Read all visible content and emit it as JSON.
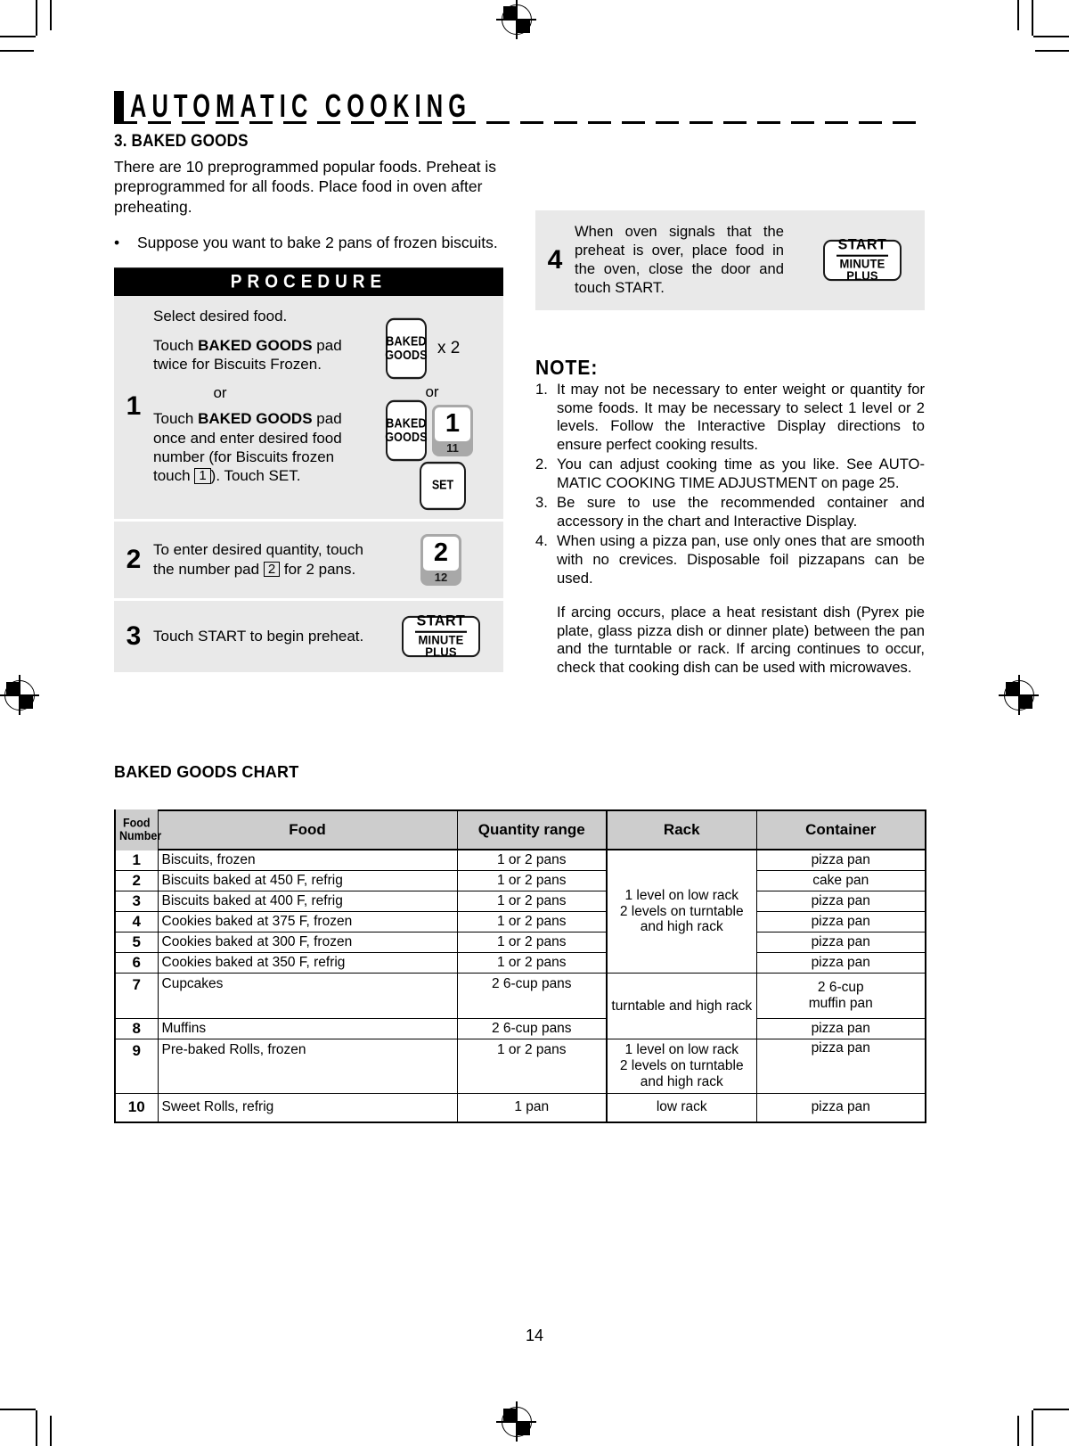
{
  "document": {
    "banner_title": "AUTOMATIC COOKING",
    "page_number": "14"
  },
  "section": {
    "heading": "3. BAKED GOODS",
    "intro": "There are 10 preprogrammed popular foods. Preheat is preprogrammed for all foods. Place food in oven after  preheating.",
    "bullet_mark": "•",
    "bullet_text": "Suppose you want to bake 2 pans of frozen biscuits."
  },
  "procedure": {
    "header": "PROCEDURE",
    "steps": [
      {
        "number": "1",
        "line_intro": "Select desired food.",
        "text_a_pre": "Touch ",
        "text_a_bold": "BAKED GOODS",
        "text_a_post": " pad twice for Biscuits Frozen.",
        "or_label": "or",
        "text_b_pre": "Touch ",
        "text_b_bold": "BAKED GOODS",
        "text_b_post_1": " pad once and enter desired food number (for Biscuits frozen touch ",
        "text_b_boxed": "1",
        "text_b_post_2": "). Touch SET.",
        "keys": {
          "baked_goods_label_line1": "BAKED",
          "baked_goods_label_line2": "GOODS",
          "times_label": "x 2",
          "or_label": "or",
          "num_key_main": "1",
          "num_key_sub": "11",
          "set_label": "SET"
        }
      },
      {
        "number": "2",
        "text_pre": "To enter desired quantity, touch the number pad ",
        "text_boxed": "2",
        "text_post": " for 2 pans.",
        "keys": {
          "num_key_main": "2",
          "num_key_sub": "12"
        }
      },
      {
        "number": "3",
        "text": "Touch  START  to  begin preheat.",
        "keys": {
          "start_top": "START",
          "start_bottom": "MINUTE PLUS"
        }
      },
      {
        "number": "4",
        "text": "When  oven  signals  that the preheat is over, place food in the oven, close the door and touch START.",
        "keys": {
          "start_top": "START",
          "start_bottom": "MINUTE PLUS"
        }
      }
    ]
  },
  "note": {
    "title": "NOTE:",
    "items": [
      {
        "n": "1.",
        "text": "It may not be necessary to enter weight or quantity for some foods. It may be necessary to select 1 level or 2 levels. Follow the Interactive Display directions to ensure perfect cooking results."
      },
      {
        "n": "2.",
        "text": "You can adjust cooking time as you like. See AUTO-MATIC COOKING TIME ADJUSTMENT on page 25."
      },
      {
        "n": "3.",
        "text": "Be sure to use the recommended container and accessory in the chart and Interactive Display."
      },
      {
        "n": "4.",
        "text": "When using a pizza pan, use only ones that are smooth with no crevices. Disposable foil pizzapans can be used."
      }
    ],
    "extra_paragraph": "If arcing occurs, place a heat resistant dish (Pyrex pie plate, glass pizza dish or dinner plate) between the pan and the turntable or rack. If arcing continues to occur, check that cooking dish can be used with microwaves."
  },
  "chart": {
    "title": "BAKED GOODS CHART",
    "headers": {
      "food_number_line1": "Food",
      "food_number_line2": "Number",
      "food": "Food",
      "quantity_range": "Quantity range",
      "rack": "Rack",
      "container": "Container"
    },
    "rows": [
      {
        "number": "1",
        "food": "Biscuits, frozen",
        "quantity": "1 or 2 pans",
        "container": "pizza pan"
      },
      {
        "number": "2",
        "food": "Biscuits baked at 450 F, refrig",
        "quantity": "1 or 2 pans",
        "container": "cake pan"
      },
      {
        "number": "3",
        "food": "Biscuits baked at 400 F, refrig",
        "quantity": "1 or 2 pans",
        "container": "pizza pan"
      },
      {
        "number": "4",
        "food": "Cookies baked at 375 F, frozen",
        "quantity": "1 or 2 pans",
        "container": "pizza pan"
      },
      {
        "number": "5",
        "food": "Cookies baked at 300 F, frozen",
        "quantity": "1 or 2 pans",
        "container": "pizza pan"
      },
      {
        "number": "6",
        "food": "Cookies baked at 350 F, refrig",
        "quantity": "1 or 2 pans",
        "container": "pizza pan"
      },
      {
        "number": "7",
        "food": "Cupcakes",
        "quantity": "2 6-cup pans",
        "container": "2 6-cup\nmuffin pan"
      },
      {
        "number": "8",
        "food": "Muffins",
        "quantity": "2 6-cup pans",
        "container": "pizza pan"
      },
      {
        "number": "9",
        "food": "Pre-baked Rolls, frozen",
        "quantity": "1 or 2 pans",
        "container": "pizza pan"
      },
      {
        "number": "10",
        "food": "Sweet Rolls, refrig",
        "quantity": "1 pan",
        "container": "pizza pan"
      }
    ],
    "rack_groups": [
      {
        "text": "1 level on low rack\n2 levels on turntable\nand high rack",
        "rows": 6
      },
      {
        "text": "turntable and high rack",
        "rows": 2
      },
      {
        "text": "1 level on low rack\n2 levels on turntable\nand high rack",
        "rows": 1
      },
      {
        "text": "low rack",
        "rows": 1
      }
    ]
  }
}
